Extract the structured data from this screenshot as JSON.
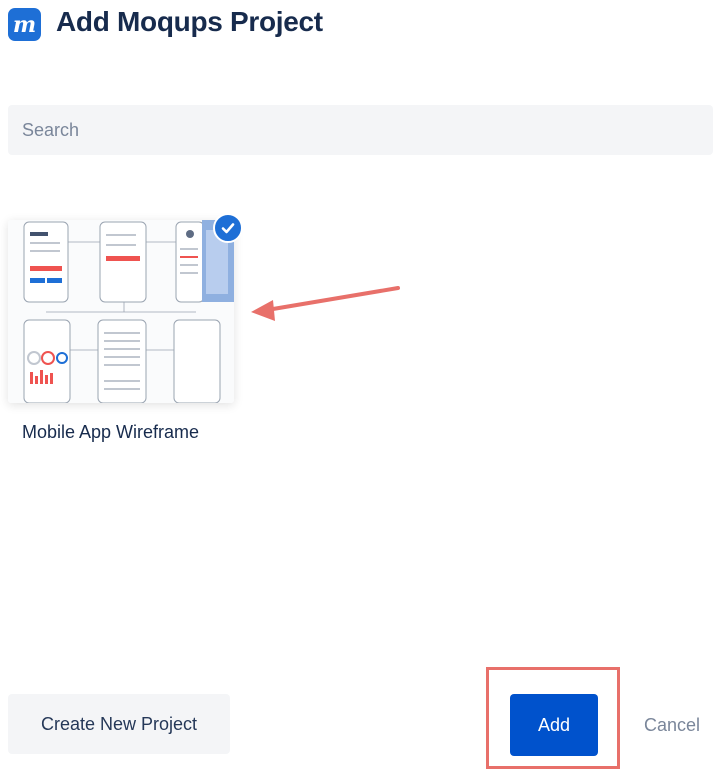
{
  "header": {
    "logo_glyph": "m",
    "title": "Add Moqups Project"
  },
  "search": {
    "placeholder": "Search",
    "value": ""
  },
  "projects": [
    {
      "name": "Mobile App Wireframe",
      "selected": true
    }
  ],
  "footer": {
    "create_label": "Create New Project",
    "add_label": "Add",
    "cancel_label": "Cancel"
  },
  "colors": {
    "brand_blue": "#1e6fd6",
    "primary_button": "#0052cc",
    "annotation_red": "#e8706a"
  }
}
